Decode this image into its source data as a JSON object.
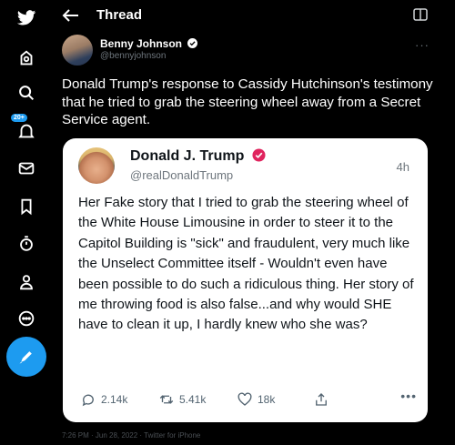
{
  "header": {
    "title": "Thread"
  },
  "post": {
    "author_name": "Benny Johnson",
    "author_handle": "@bennyjohnson",
    "text": "Donald Trump's response to Cassidy Hutchinson's testimony that he tried to grab the steering wheel away from a Secret Service agent.",
    "meta": "7:26 PM · Jun 28, 2022 · Twitter for iPhone"
  },
  "sidebar": {
    "notification_badge": "20+"
  },
  "quoted": {
    "author_name": "Donald J. Trump",
    "author_handle": "@realDonaldTrump",
    "time": "4h",
    "text": "Her Fake story that I tried to grab the steering wheel of the White House Limousine in order to steer it to the Capitol Building is \"sick\" and fraudulent, very much like the Unselect Committee itself - Wouldn't even have been possible to do such a ridiculous thing. Her story of me throwing food is also false...and why would SHE have to clean it up, I hardly knew who she was?",
    "replies": "2.14k",
    "reposts": "5.41k",
    "likes": "18k"
  },
  "colors": {
    "accent": "#1d9bf0",
    "verified_red": "#e0245e",
    "background": "#000000"
  },
  "icons": [
    "bird-logo-icon",
    "home-icon",
    "search-icon",
    "notifications-icon",
    "messages-icon",
    "bookmark-icon",
    "lists-icon",
    "profile-icon",
    "more-icon",
    "compose-icon",
    "back-arrow-icon",
    "reader-icon"
  ]
}
